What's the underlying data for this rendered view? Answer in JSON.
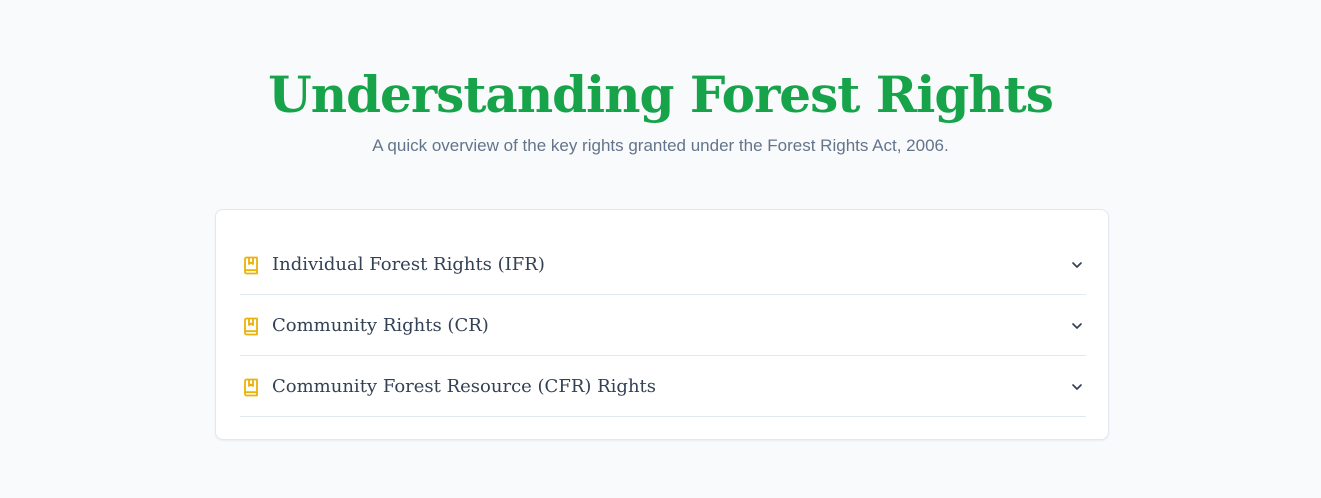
{
  "header": {
    "title": "Understanding Forest Rights",
    "subtitle": "A quick overview of the key rights granted under the Forest Rights Act, 2006."
  },
  "accordion": {
    "items": [
      {
        "label": "Individual Forest Rights (IFR)",
        "icon": "bookmark-book-icon",
        "expanded": false
      },
      {
        "label": "Community Rights (CR)",
        "icon": "bookmark-book-icon",
        "expanded": false
      },
      {
        "label": "Community Forest Resource (CFR) Rights",
        "icon": "bookmark-book-icon",
        "expanded": false
      }
    ]
  },
  "colors": {
    "title": "#16a34a",
    "subtitle": "#64748b",
    "icon": "#eab308",
    "text": "#334155",
    "border": "#e2e8f0",
    "background": "#f8fafc",
    "card": "#ffffff"
  }
}
